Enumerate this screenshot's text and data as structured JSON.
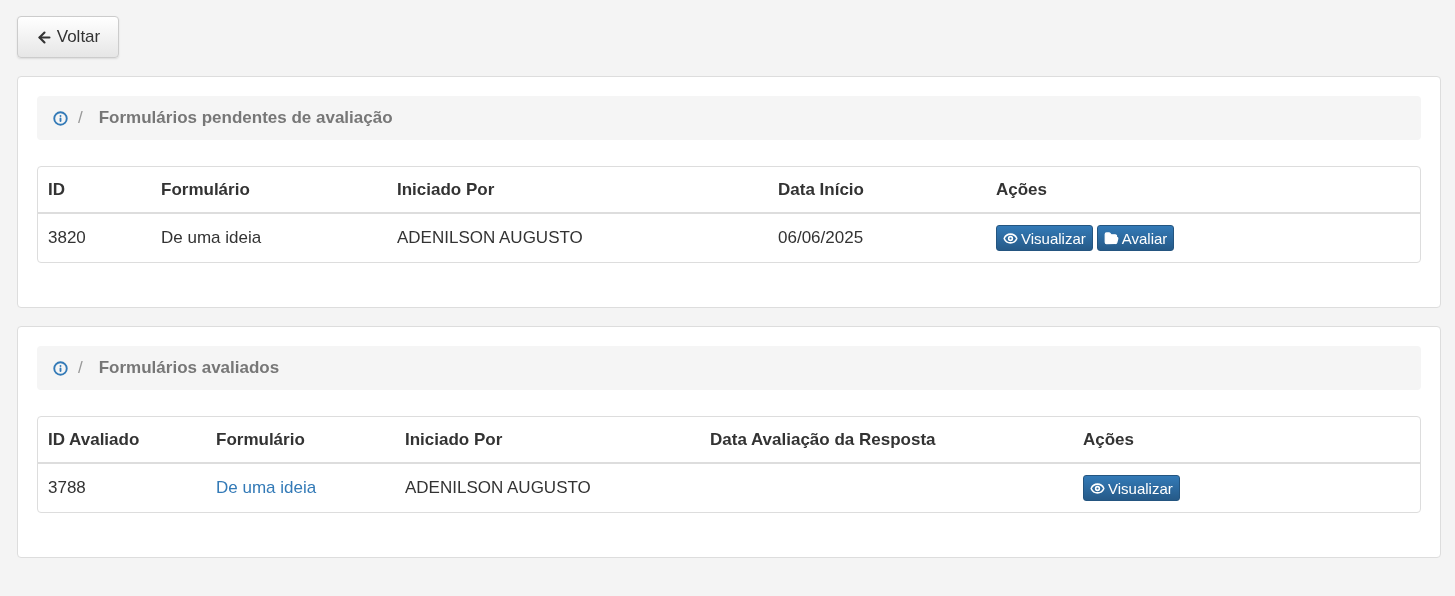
{
  "back_button": {
    "label": "Voltar"
  },
  "panels": [
    {
      "separator": "/",
      "title": "Formulários pendentes de avaliação",
      "columns": [
        "ID",
        "Formulário",
        "Iniciado Por",
        "Data Início",
        "Ações"
      ],
      "rows": [
        {
          "cells": [
            {
              "kind": "text",
              "text": "3820"
            },
            {
              "kind": "text",
              "text": "De uma ideia"
            },
            {
              "kind": "text",
              "text": "ADENILSON AUGUSTO"
            },
            {
              "kind": "text",
              "text": "06/06/2025"
            }
          ],
          "actions": [
            {
              "kind": "view",
              "label": "Visualizar"
            },
            {
              "kind": "evaluate",
              "label": "Avaliar"
            }
          ]
        }
      ]
    },
    {
      "separator": "/",
      "title": "Formulários avaliados",
      "columns": [
        "ID Avaliado",
        "Formulário",
        "Iniciado Por",
        "Data Avaliação da Resposta",
        "Ações"
      ],
      "rows": [
        {
          "cells": [
            {
              "kind": "text",
              "text": "3788"
            },
            {
              "kind": "link",
              "text": "De uma ideia"
            },
            {
              "kind": "text",
              "text": "ADENILSON AUGUSTO"
            },
            {
              "kind": "empty"
            }
          ],
          "actions": [
            {
              "kind": "view",
              "label": "Visualizar"
            }
          ]
        }
      ]
    }
  ]
}
